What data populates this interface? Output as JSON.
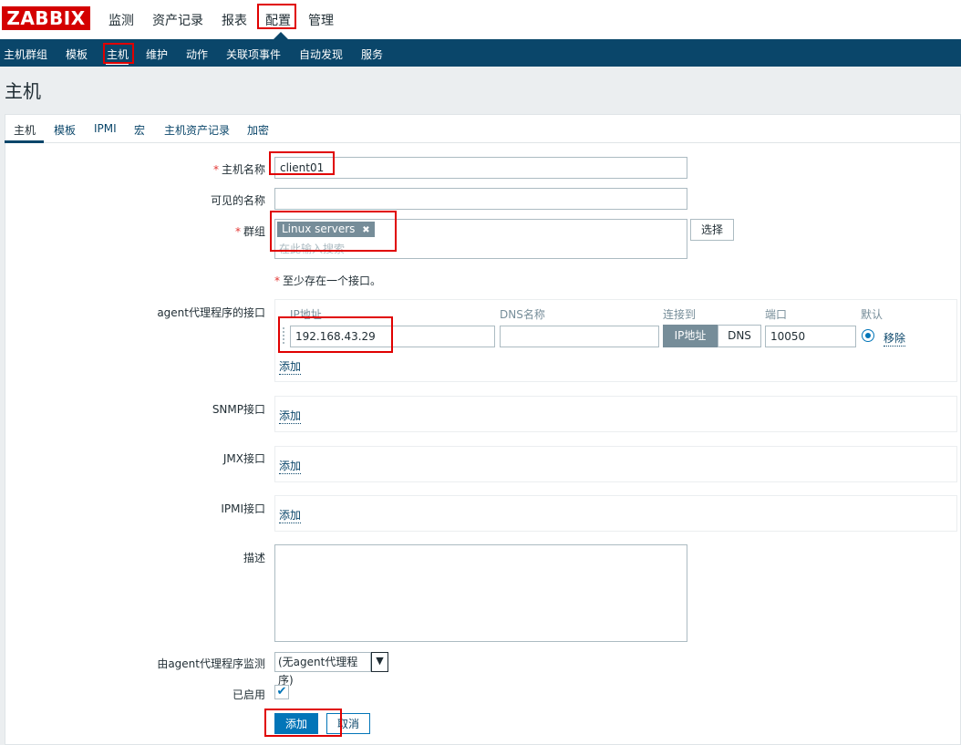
{
  "logo": "ZABBIX",
  "top_nav": [
    "监测",
    "资产记录",
    "报表",
    "配置",
    "管理"
  ],
  "sub_nav": [
    "主机群组",
    "模板",
    "主机",
    "维护",
    "动作",
    "关联项事件",
    "自动发现",
    "服务"
  ],
  "page_title": "主机",
  "tabs": [
    "主机",
    "模板",
    "IPMI",
    "宏",
    "主机资产记录",
    "加密"
  ],
  "form": {
    "host_name_label": "主机名称",
    "host_name_value": "client01",
    "visible_name_label": "可见的名称",
    "visible_name_value": "",
    "groups_label": "群组",
    "group_tag": "Linux servers",
    "group_tag_remove": "✖",
    "groups_placeholder": "在此输入搜索",
    "select_button": "选择",
    "interface_note": "至少存在一个接口。",
    "required_mark": "*",
    "agent_interfaces_label": "agent代理程序的接口",
    "col_ip": "IP地址",
    "col_dns": "DNS名称",
    "col_connect": "连接到",
    "col_port": "端口",
    "col_default": "默认",
    "ip_value": "192.168.43.29",
    "dns_value": "",
    "connect_ip": "IP地址",
    "connect_dns": "DNS",
    "port_value": "10050",
    "remove_link": "移除",
    "add_link": "添加",
    "snmp_label": "SNMP接口",
    "jmx_label": "JMX接口",
    "ipmi_label": "IPMI接口",
    "description_label": "描述",
    "description_value": "",
    "proxy_label": "由agent代理程序监测",
    "proxy_selected": "(无agent代理程序)",
    "enabled_label": "已启用",
    "enabled": true,
    "add_button": "添加",
    "cancel_button": "取消"
  },
  "colors": {
    "accent": "#0a466a",
    "logo_red": "#d40000",
    "required": "#e33734",
    "highlight_box": "#e00000"
  }
}
